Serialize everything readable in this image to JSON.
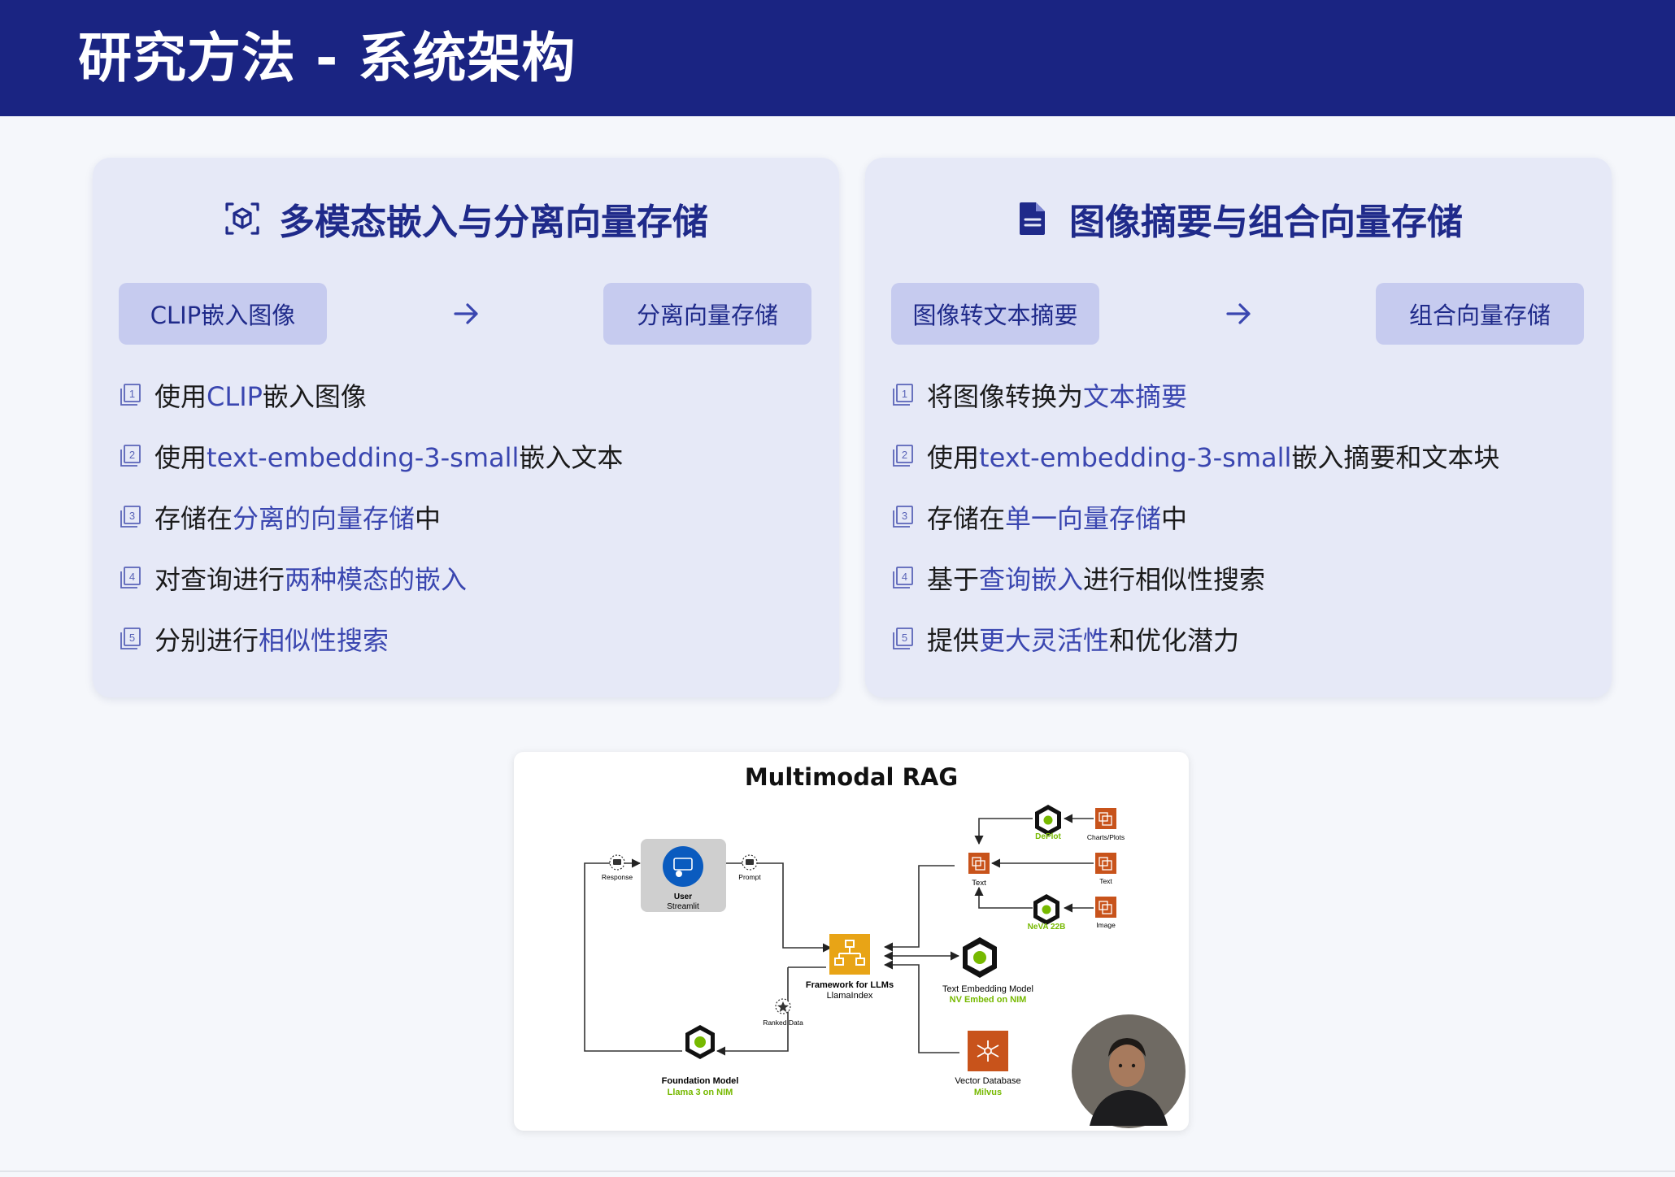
{
  "header": {
    "title": "研究方法 - 系统架构"
  },
  "left_card": {
    "icon": "cube-icon",
    "title": "多模态嵌入与分离向量存储",
    "flow": {
      "from": "CLIP嵌入图像",
      "to": "分离向量存储"
    },
    "items": [
      {
        "pre": "使用",
        "hl": "CLIP",
        "post": "嵌入图像"
      },
      {
        "pre": "使用",
        "hl": "text-embedding-3-small",
        "post": "嵌入文本"
      },
      {
        "pre": "存储在",
        "hl": "分离的向量存储",
        "post": "中"
      },
      {
        "pre": "对查询进行",
        "hl": "两种模态的嵌入",
        "post": ""
      },
      {
        "pre": "分别进行",
        "hl": "相似性搜索",
        "post": ""
      }
    ]
  },
  "right_card": {
    "icon": "document-icon",
    "title": "图像摘要与组合向量存储",
    "flow": {
      "from": "图像转文本摘要",
      "to": "组合向量存储"
    },
    "items": [
      {
        "pre": "将图像转换为",
        "hl": "文本摘要",
        "post": ""
      },
      {
        "pre": "使用",
        "hl": "text-embedding-3-small",
        "post": "嵌入摘要和文本块"
      },
      {
        "pre": "存储在",
        "hl": "单一向量存储",
        "post": "中"
      },
      {
        "pre": "基于",
        "hl": "查询嵌入",
        "post": "进行相似性搜索"
      },
      {
        "pre": "提供",
        "hl": "更大灵活性",
        "post": "和优化潜力"
      }
    ]
  },
  "figure": {
    "title": "Multimodal RAG",
    "nodes": {
      "user": {
        "name": "User",
        "sub": "Streamlit"
      },
      "response": "Response",
      "prompt": "Prompt",
      "framework": {
        "name": "Framework for LLMs",
        "sub": "LlamaIndex"
      },
      "ranked": "Ranked Data",
      "foundation": {
        "name": "Foundation Model",
        "sub": "Llama 3 on NIM"
      },
      "text_embed": {
        "name": "Text Embedding Model",
        "sub": "NV Embed on NIM"
      },
      "vector_db": {
        "name": "Vector Database",
        "sub": "Milvus"
      },
      "deplot": "DePlot",
      "charts": "Charts/Plots",
      "text_mid": "Text",
      "text_right": "Text",
      "neva": "NeVA 22B",
      "image": "Image"
    }
  },
  "colors": {
    "header_bg": "#1a2482",
    "title": "#1f2a8a",
    "highlight": "#3a46b0",
    "card_bg": "#e6e9f7",
    "pill_bg": "#c6cbef",
    "nvidia_green": "#76b900",
    "orange": "#c8531b",
    "gold": "#e8a416"
  }
}
